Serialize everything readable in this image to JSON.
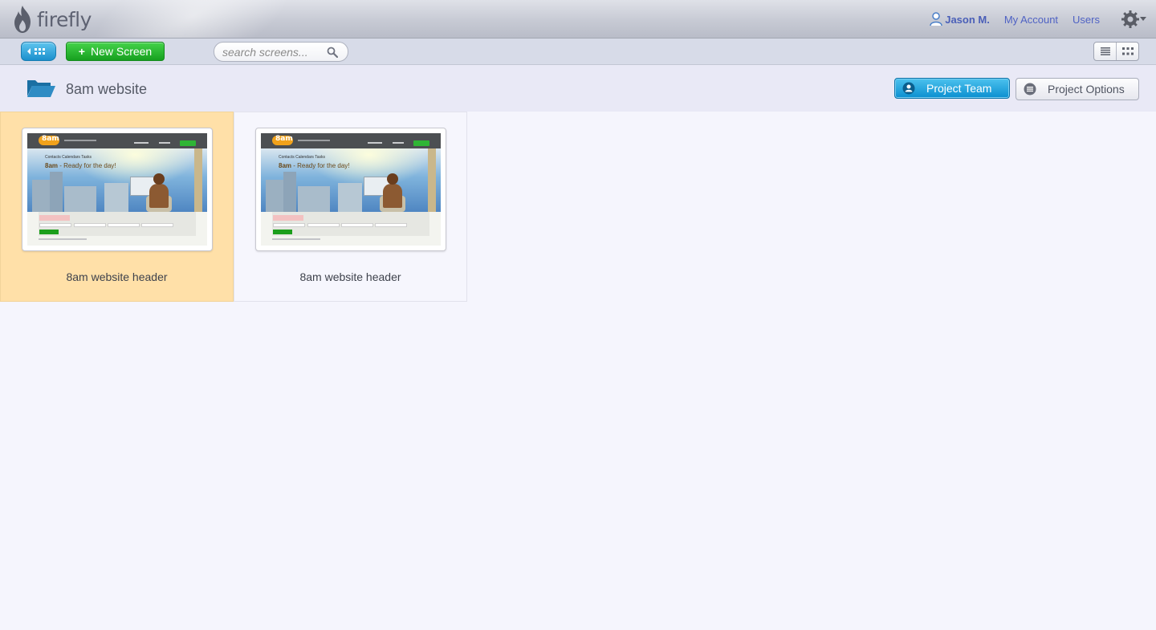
{
  "app": {
    "logo_text": "firefly"
  },
  "user_nav": {
    "user_name": "Jason M.",
    "my_account": "My Account",
    "users": "Users"
  },
  "toolbar": {
    "new_screen_label": "New Screen",
    "new_screen_prefix": "+",
    "search_placeholder": "search screens..."
  },
  "project": {
    "title": "8am website",
    "team_button": "Project Team",
    "options_button": "Project Options"
  },
  "screens": [
    {
      "caption": "8am website header",
      "selected": true,
      "preview": {
        "logo": "8am",
        "tabs": "Contacts   Calendars   Tasks",
        "headline_bold": "8am",
        "headline_rest": " - Ready for the day!"
      }
    },
    {
      "caption": "8am website header",
      "selected": false,
      "preview": {
        "logo": "8am",
        "tabs": "Contacts   Calendars   Tasks",
        "headline_bold": "8am",
        "headline_rest": " - Ready for the day!"
      }
    }
  ],
  "colors": {
    "accent_blue": "#0b8fd0",
    "new_screen_green": "#16a01f",
    "selected_card": "#ffe0a8",
    "link_blue": "#4f62c4"
  },
  "icons": {
    "logo": "flame-icon",
    "user": "user-icon",
    "settings": "gear-icon",
    "back": "grid-back-icon",
    "search": "search-icon",
    "list_view": "list-view-icon",
    "grid_view": "grid-view-icon",
    "folder": "folder-icon",
    "team": "person-circle-icon",
    "options": "menu-circle-icon"
  }
}
